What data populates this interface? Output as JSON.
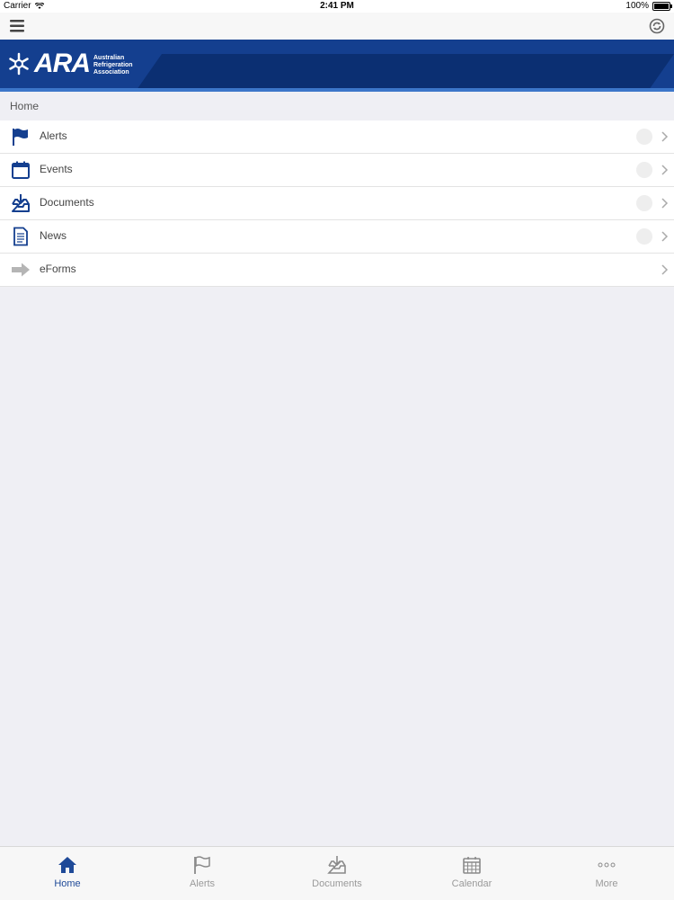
{
  "status": {
    "carrier": "Carrier",
    "time": "2:41 PM",
    "battery": "100%"
  },
  "banner": {
    "logo": "ARA",
    "org_name_1": "Australian",
    "org_name_2": "Refrigeration",
    "org_name_3": "Association"
  },
  "breadcrumb": "Home",
  "menu": [
    {
      "label": "Alerts",
      "icon": "flag-icon"
    },
    {
      "label": "Events",
      "icon": "calendar-icon"
    },
    {
      "label": "Documents",
      "icon": "inbox-download-icon"
    },
    {
      "label": "News",
      "icon": "document-icon"
    },
    {
      "label": "eForms",
      "icon": "arrow-right-icon"
    }
  ],
  "tabs": [
    {
      "label": "Home",
      "icon": "home-icon",
      "active": true
    },
    {
      "label": "Alerts",
      "icon": "flag-icon"
    },
    {
      "label": "Documents",
      "icon": "inbox-download-icon"
    },
    {
      "label": "Calendar",
      "icon": "calendar-grid-icon"
    },
    {
      "label": "More",
      "icon": "more-dots-icon"
    }
  ],
  "colors": {
    "brand_blue": "#143f8f",
    "active_tab": "#1f4a98",
    "inactive_tab": "#9a9a9a"
  }
}
